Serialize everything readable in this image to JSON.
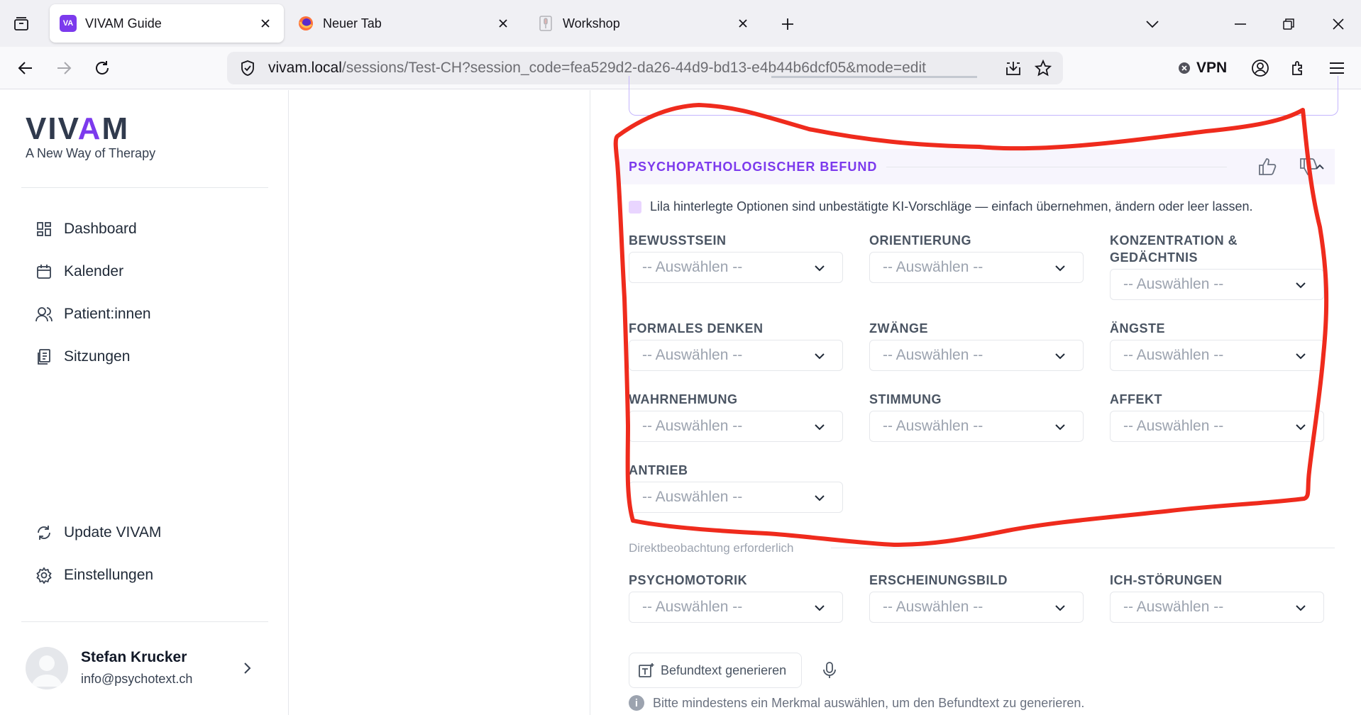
{
  "browser": {
    "tabs": [
      {
        "title": "VIVAM Guide",
        "favicon": "VA",
        "active": true
      },
      {
        "title": "Neuer Tab",
        "favicon": "firefox-icon",
        "active": false
      },
      {
        "title": "Workshop",
        "favicon": "microphone-icon",
        "active": false
      }
    ],
    "url_host": "vivam.local",
    "url_path": "/sessions/Test-CH?session_code=fea529d2-da26-44d9-bd13-e4b44b6dcf05&mode=edit",
    "vpn_label": "VPN"
  },
  "sidebar": {
    "logo": {
      "left": "VIV",
      "accent": "A",
      "right": "M"
    },
    "tagline": "A New Way of Therapy",
    "nav": [
      {
        "label": "Dashboard",
        "icon": "dashboard-icon"
      },
      {
        "label": "Kalender",
        "icon": "calendar-icon"
      },
      {
        "label": "Patient:innen",
        "icon": "users-icon"
      },
      {
        "label": "Sitzungen",
        "icon": "sessions-icon"
      }
    ],
    "bottom_nav": [
      {
        "label": "Update VIVAM",
        "icon": "refresh-icon"
      },
      {
        "label": "Einstellungen",
        "icon": "gear-icon"
      }
    ],
    "user": {
      "name": "Stefan Krucker",
      "email": "info@psychotext.ch"
    }
  },
  "section": {
    "title": "PSYCHOPATHOLOGISCHER BEFUND",
    "hint": "Lila hinterlegte Optionen sind unbestätigte KI-Vorschläge — einfach übernehmen, ändern oder leer lassen.",
    "placeholder": "-- Auswählen --",
    "fields": [
      {
        "label": "BEWUSSTSEIN"
      },
      {
        "label": "ORIENTIERUNG"
      },
      {
        "label": "KONZENTRATION &\nGEDÄCHTNIS"
      },
      {
        "label": "FORMALES DENKEN"
      },
      {
        "label": "ZWÄNGE"
      },
      {
        "label": "ÄNGSTE"
      },
      {
        "label": "WAHRNEHMUNG"
      },
      {
        "label": "STIMMUNG"
      },
      {
        "label": "AFFEKT"
      },
      {
        "label": "ANTRIEB"
      }
    ],
    "subsection": "Direktbeobachtung erforderlich",
    "observation_fields": [
      {
        "label": "PSYCHOMOTORIK"
      },
      {
        "label": "ERSCHEINUNGSBILD"
      },
      {
        "label": "ICH-STÖRUNGEN"
      }
    ],
    "generate_button": "Befundtext generieren",
    "info": "Bitte mindestens ein Merkmal auswählen, um den Befundtext zu generieren."
  },
  "colors": {
    "accent": "#7c3aed",
    "annotation": "#ef2b1d"
  }
}
